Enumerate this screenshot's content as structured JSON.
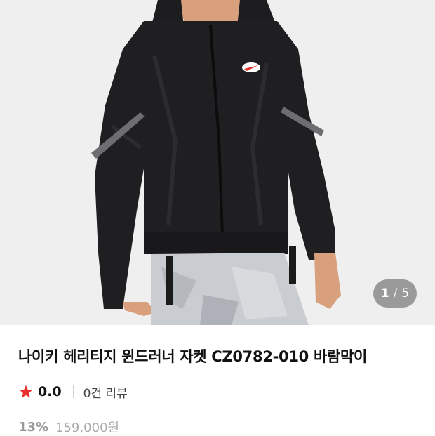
{
  "image": {
    "description_icon": "product-photo",
    "indicator_current": "1",
    "indicator_separator": "/",
    "indicator_total": "5"
  },
  "product": {
    "title": "나이키 헤리티지 윈드러너 자켓 CZ0782-010 바람막이",
    "rating": "0.0",
    "review_count": "0건 리뷰",
    "discount": "13%",
    "original_price": "159,000원"
  },
  "colors": {
    "star": "#e8322d",
    "indicator_bg": "#7a7a7a"
  }
}
